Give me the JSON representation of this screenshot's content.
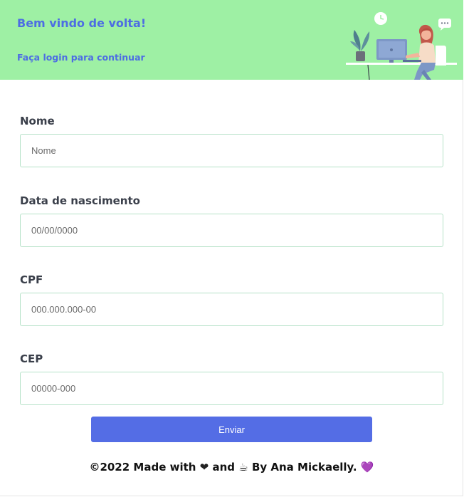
{
  "header": {
    "welcome": "Bem vindo de volta!",
    "subtitle": "Faça login para continuar",
    "illustration": "person-at-desk-illustration"
  },
  "form": {
    "fields": [
      {
        "label": "Nome",
        "placeholder": "Nome"
      },
      {
        "label": "Data de nascimento",
        "placeholder": "00/00/0000"
      },
      {
        "label": "CPF",
        "placeholder": "000.000.000-00"
      },
      {
        "label": "CEP",
        "placeholder": "00000-000"
      }
    ],
    "submit_label": "Enviar"
  },
  "footer": {
    "prefix": "©2022 Made with",
    "heart": "❤",
    "and": "and",
    "coffee": "☕",
    "by": "By Ana Mickaelly.",
    "purple_heart": "💜"
  },
  "colors": {
    "header_bg": "#9ef0a4",
    "accent": "#4d6de3",
    "button": "#546de5",
    "input_border": "#b6e2c8"
  }
}
